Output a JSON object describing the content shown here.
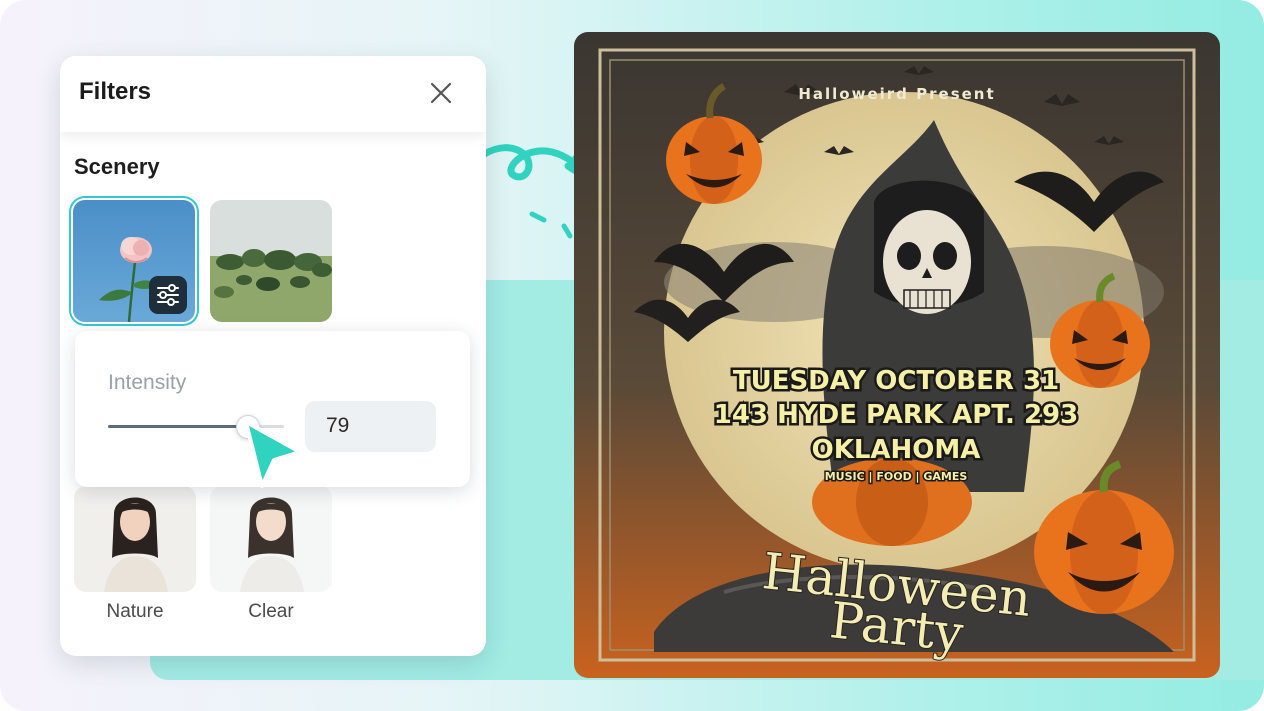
{
  "panel": {
    "title": "Filters",
    "section_title": "Scenery",
    "thumbnails": [
      {
        "label": "Nature"
      },
      {
        "label": "Clear"
      }
    ]
  },
  "intensity": {
    "label": "Intensity",
    "value": "79",
    "level_percent": 79
  },
  "poster": {
    "presenter": "Halloweird Present",
    "line1": "TUESDAY OCTOBER 31",
    "line2": "143 HYDE PARK APT. 293",
    "line3": "OKLAHOMA",
    "tagline": "MUSIC | FOOD | GAMES",
    "title_line1": "Halloween",
    "title_line2": "Party"
  },
  "colors": {
    "accent": "#35c8cf",
    "cursor": "#2fd3bf",
    "poster_text": "#f6f0a6",
    "pumpkin": "#e8731c"
  },
  "icons": [
    "close-icon",
    "sliders-icon",
    "pointer-cursor-icon",
    "curved-arrow-icon"
  ]
}
